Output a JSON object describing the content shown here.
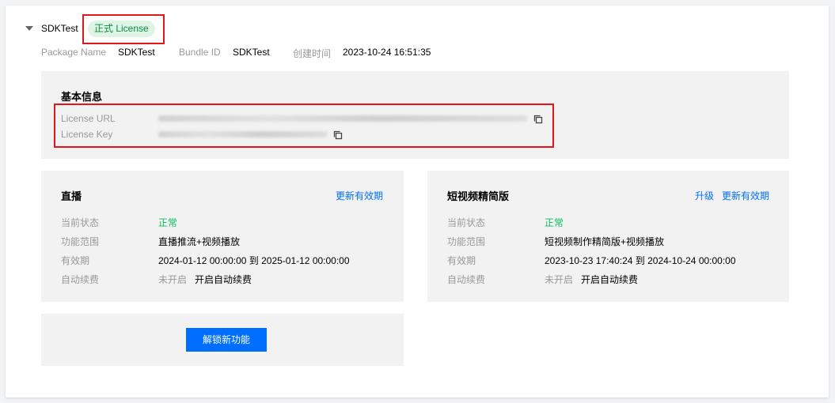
{
  "header": {
    "app_name": "SDKTest",
    "license_badge": "正式 License",
    "package_label": "Package Name",
    "package_value": "SDKTest",
    "bundle_label": "Bundle ID",
    "bundle_value": "SDKTest",
    "created_label": "创建时间",
    "created_value": "2023-10-24 16:51:35"
  },
  "basic_info": {
    "title": "基本信息",
    "url_label": "License URL",
    "key_label": "License Key"
  },
  "live": {
    "title": "直播",
    "renew_link": "更新有效期",
    "status_label": "当前状态",
    "status_value": "正常",
    "scope_label": "功能范围",
    "scope_value": "直播推流+视频播放",
    "validity_label": "有效期",
    "validity_value": "2024-01-12 00:00:00 到 2025-01-12 00:00:00",
    "autorenew_label": "自动续费",
    "autorenew_value": "未开启",
    "autorenew_link": "开启自动续费"
  },
  "short_video": {
    "title": "短视频精简版",
    "upgrade_link": "升级",
    "renew_link": "更新有效期",
    "status_label": "当前状态",
    "status_value": "正常",
    "scope_label": "功能范围",
    "scope_value": "短视频制作精简版+视频播放",
    "validity_label": "有效期",
    "validity_value": "2023-10-23 17:40:24 到 2024-10-24 00:00:00",
    "autorenew_label": "自动续费",
    "autorenew_value": "未开启",
    "autorenew_link": "开启自动续费"
  },
  "unlock": {
    "button_label": "解锁新功能"
  },
  "colors": {
    "accent": "#006eff",
    "ok": "#0abf5b",
    "highlight_box": "#e1161b",
    "badge_bg": "#dff4e6",
    "badge_text": "#0a8f3f"
  },
  "icons": {
    "expand": "caret-down-icon",
    "copy": "copy-icon"
  }
}
